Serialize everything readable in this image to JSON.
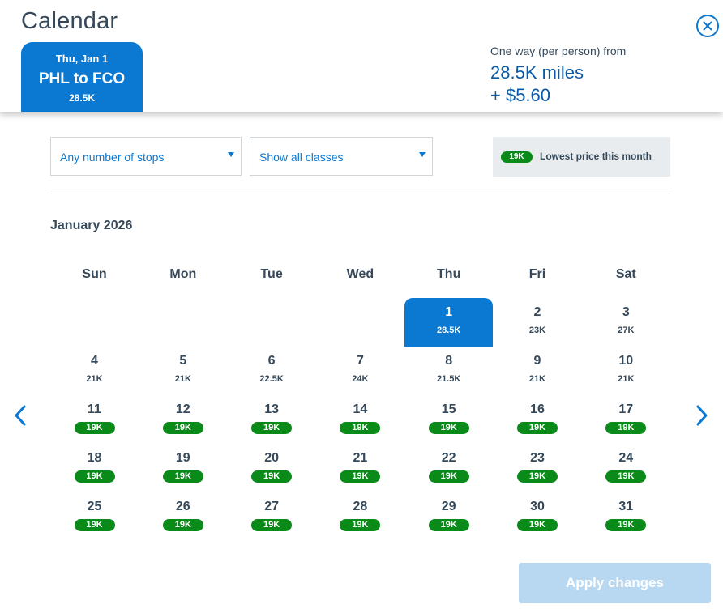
{
  "header": {
    "title": "Calendar",
    "flight_tab": {
      "date": "Thu, Jan 1",
      "route": "PHL to FCO",
      "price": "28.5K"
    },
    "price_summary": {
      "label": "One way (per person) from",
      "miles": "28.5K miles",
      "fee": "+ $5.60"
    },
    "close_icon": "close-circle-icon"
  },
  "filters": {
    "stops": "Any number of stops",
    "classes": "Show all classes"
  },
  "legend": {
    "pill": "19K",
    "text": "Lowest price this month",
    "pill_color": "#0a8a19"
  },
  "calendar": {
    "month": "January 2026",
    "weekdays": [
      "Sun",
      "Mon",
      "Tue",
      "Wed",
      "Thu",
      "Fri",
      "Sat"
    ],
    "first_weekday_index": 4,
    "selected_day": 1,
    "days": [
      {
        "d": "1",
        "p": "28.5K",
        "low": false
      },
      {
        "d": "2",
        "p": "23K",
        "low": false
      },
      {
        "d": "3",
        "p": "27K",
        "low": false
      },
      {
        "d": "4",
        "p": "21K",
        "low": false
      },
      {
        "d": "5",
        "p": "21K",
        "low": false
      },
      {
        "d": "6",
        "p": "22.5K",
        "low": false
      },
      {
        "d": "7",
        "p": "24K",
        "low": false
      },
      {
        "d": "8",
        "p": "21.5K",
        "low": false
      },
      {
        "d": "9",
        "p": "21K",
        "low": false
      },
      {
        "d": "10",
        "p": "21K",
        "low": false
      },
      {
        "d": "11",
        "p": "19K",
        "low": true
      },
      {
        "d": "12",
        "p": "19K",
        "low": true
      },
      {
        "d": "13",
        "p": "19K",
        "low": true
      },
      {
        "d": "14",
        "p": "19K",
        "low": true
      },
      {
        "d": "15",
        "p": "19K",
        "low": true
      },
      {
        "d": "16",
        "p": "19K",
        "low": true
      },
      {
        "d": "17",
        "p": "19K",
        "low": true
      },
      {
        "d": "18",
        "p": "19K",
        "low": true
      },
      {
        "d": "19",
        "p": "19K",
        "low": true
      },
      {
        "d": "20",
        "p": "19K",
        "low": true
      },
      {
        "d": "21",
        "p": "19K",
        "low": true
      },
      {
        "d": "22",
        "p": "19K",
        "low": true
      },
      {
        "d": "23",
        "p": "19K",
        "low": true
      },
      {
        "d": "24",
        "p": "19K",
        "low": true
      },
      {
        "d": "25",
        "p": "19K",
        "low": true
      },
      {
        "d": "26",
        "p": "19K",
        "low": true
      },
      {
        "d": "27",
        "p": "19K",
        "low": true
      },
      {
        "d": "28",
        "p": "19K",
        "low": true
      },
      {
        "d": "29",
        "p": "19K",
        "low": true
      },
      {
        "d": "30",
        "p": "19K",
        "low": true
      },
      {
        "d": "31",
        "p": "19K",
        "low": true
      }
    ],
    "prev_icon": "chevron-left-icon",
    "next_icon": "chevron-right-icon"
  },
  "footer": {
    "apply_label": "Apply changes"
  },
  "colors": {
    "accent": "#0b78d1",
    "low_price": "#0a8a19",
    "apply_disabled": "#b8d8f2",
    "text": "#36495a"
  }
}
